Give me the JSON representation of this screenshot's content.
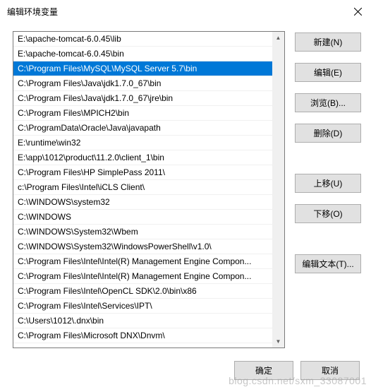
{
  "title": "编辑环境变量",
  "list": {
    "selected_index": 2,
    "items": [
      "E:\\apache-tomcat-6.0.45\\lib",
      "E:\\apache-tomcat-6.0.45\\bin",
      "C:\\Program Files\\MySQL\\MySQL Server 5.7\\bin",
      "C:\\Program Files\\Java\\jdk1.7.0_67\\bin",
      "C:\\Program Files\\Java\\jdk1.7.0_67\\jre\\bin",
      "C:\\Program Files\\MPICH2\\bin",
      "C:\\ProgramData\\Oracle\\Java\\javapath",
      "E:\\runtime\\win32",
      "E:\\app\\1012\\product\\11.2.0\\client_1\\bin",
      "C:\\Program Files\\HP SimplePass 2011\\",
      "c:\\Program Files\\Intel\\iCLS Client\\",
      "C:\\WINDOWS\\system32",
      "C:\\WINDOWS",
      "C:\\WINDOWS\\System32\\Wbem",
      "C:\\WINDOWS\\System32\\WindowsPowerShell\\v1.0\\",
      "C:\\Program Files\\Intel\\Intel(R) Management Engine Compon...",
      "C:\\Program Files\\Intel\\Intel(R) Management Engine Compon...",
      "C:\\Program Files\\Intel\\OpenCL SDK\\2.0\\bin\\x86",
      "C:\\Program Files\\Intel\\Services\\IPT\\",
      "C:\\Users\\1012\\.dnx\\bin",
      "C:\\Program Files\\Microsoft DNX\\Dnvm\\"
    ]
  },
  "buttons": {
    "new": "新建(N)",
    "edit": "编辑(E)",
    "browse": "浏览(B)...",
    "delete": "删除(D)",
    "move_up": "上移(U)",
    "move_down": "下移(O)",
    "edit_text": "编辑文本(T)...",
    "ok": "确定",
    "cancel": "取消"
  },
  "watermark": "blog.csdn.net/sxm_33087001"
}
